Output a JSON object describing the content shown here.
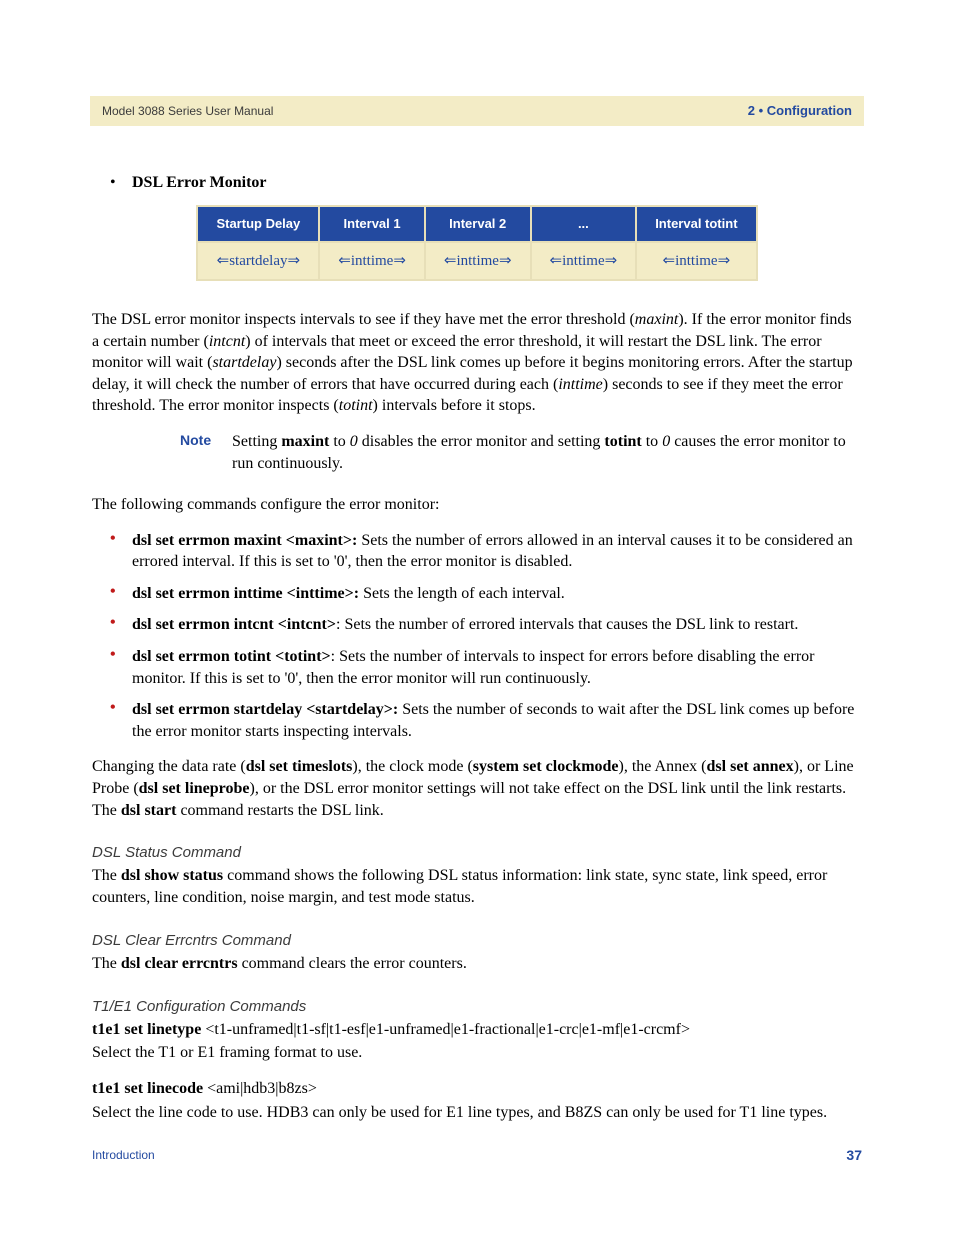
{
  "banner": {
    "left": "Model 3088 Series User Manual",
    "right": "2 • Configuration"
  },
  "section_bullet": "DSL Error Monitor",
  "table": {
    "headers": [
      "Startup Delay",
      "Interval 1",
      "Interval 2",
      "...",
      "Interval totint"
    ],
    "row": [
      "⇐startdelay⇒",
      "⇐inttime⇒",
      "⇐inttime⇒",
      "⇐inttime⇒",
      "⇐inttime⇒"
    ]
  },
  "para1_parts": {
    "a": "The DSL error monitor inspects intervals to see if they have met the error threshold (",
    "b": "maxint",
    "c": "). If the error monitor finds a certain number (",
    "d": "intcnt",
    "e": ") of intervals that meet or exceed the error threshold, it will restart the DSL link. The error monitor will wait (",
    "f": "startdelay",
    "g": ") seconds after the DSL link comes up before it begins monitoring errors. After the startup delay, it will check the number of errors that have occurred during each (",
    "h": "inttime",
    "i": ") seconds to see if they meet the error threshold. The error monitor inspects (",
    "j": "totint",
    "k": ") intervals before it stops."
  },
  "note": {
    "label": "Note",
    "text_parts": {
      "a": "Setting ",
      "b": "maxint",
      "c": " to ",
      "d": "0",
      "e": " disables the error monitor and setting ",
      "f": "totint",
      "g": " to ",
      "h": "0",
      "i": " causes the error monitor to run continuously."
    }
  },
  "intro_cmds": "The following commands configure the error monitor:",
  "cmds": [
    {
      "bold": "dsl set errmon maxint <maxint>:",
      "rest": " Sets the number of errors allowed in an interval causes it to be considered an errored interval. If this is set to '0', then the error monitor is disabled."
    },
    {
      "bold": "dsl set errmon inttime <inttime>:",
      "rest": " Sets the length of each interval."
    },
    {
      "bold": "dsl set errmon intcnt <intcnt>",
      "rest": ": Sets the number of errored intervals that causes the DSL link to restart."
    },
    {
      "bold": "dsl set errmon totint <totint>",
      "rest": ": Sets the number of intervals to inspect for errors before disabling the error monitor. If this is set to '0', then the error monitor will run continuously."
    },
    {
      "bold": "dsl set errmon startdelay <startdelay>:",
      "rest": " Sets the number of seconds to wait after the DSL link comes up before the error monitor starts inspecting intervals."
    }
  ],
  "para2_parts": {
    "a": "Changing the data rate (",
    "b": "dsl set timeslots",
    "c": "), the clock mode (",
    "d": "system set clockmode",
    "e": "), the Annex (",
    "f": "dsl set annex",
    "g": "), or Line Probe (",
    "h": "dsl set lineprobe",
    "i": "), or the DSL error monitor settings will not take effect on the DSL link until the link restarts. The ",
    "j": "dsl start",
    "k": " command restarts the DSL link."
  },
  "sub_status": {
    "heading": "DSL Status Command",
    "text_a": "The ",
    "text_b": "dsl show status",
    "text_c": " command shows the following DSL status information: link state, sync state, link speed, error counters, line condition, noise margin, and test mode status."
  },
  "sub_clear": {
    "heading": "DSL Clear Errcntrs Command",
    "text_a": "The ",
    "text_b": "dsl clear errcntrs",
    "text_c": " command clears the error counters."
  },
  "sub_t1e1": {
    "heading": "T1/E1 Configuration Commands",
    "line1_bold": "t1e1 set linetype",
    "line1_rest": " <t1-unframed|t1-sf|t1-esf|e1-unframed|e1-fractional|e1-crc|e1-mf|e1-crcmf>",
    "line1_desc": "Select the T1 or E1 framing format to use.",
    "line2_bold": "t1e1 set linecode",
    "line2_rest": " <ami|hdb3|b8zs>",
    "line2_desc": "Select the line code to use. HDB3 can only be used for E1 line types, and B8ZS can only be used for T1 line types."
  },
  "footer": {
    "left": "Introduction",
    "right": "37"
  }
}
